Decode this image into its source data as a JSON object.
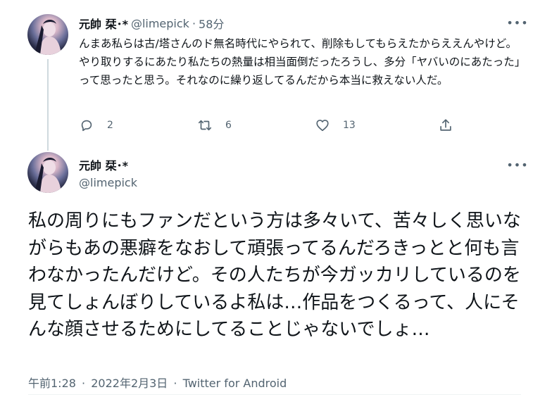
{
  "parent_tweet": {
    "display_name": "元帥 栞･*",
    "handle": "@limepick",
    "separator": "·",
    "time_ago": "58分",
    "more_icon": "more-horizontal-icon",
    "text": "んまあ私らは古/塔さんのド無名時代にやられて、削除もしてもらえたからええんやけど。やり取りするにあたり私たちの熱量は相当面倒だったろうし、多分「ヤバいのにあたった」って思ったと思う。それなのに繰り返してるんだから本当に救えない人だ。",
    "actions": {
      "reply_count": "2",
      "retweet_count": "6",
      "like_count": "13"
    }
  },
  "main_tweet": {
    "display_name": "元帥 栞･*",
    "handle": "@limepick",
    "text": "私の周りにもファンだという方は多々いて、苦々しく思いながらもあの悪癖をなおして頑張ってるんだろきっとと何も言わなかったんだけど。その人たちが今ガッカリしているのを見てしょんぼりしているよ私は…作品をつくるって、人にそんな顔させるためにしてることじゃないでしょ…",
    "time": "午前1:28",
    "date": "2022年2月3日",
    "separator": "·",
    "client": "Twitter for Android"
  },
  "colors": {
    "text_primary": "#0f1419",
    "text_secondary": "#536471",
    "thread_line": "#cfd9de",
    "background": "#ffffff"
  }
}
